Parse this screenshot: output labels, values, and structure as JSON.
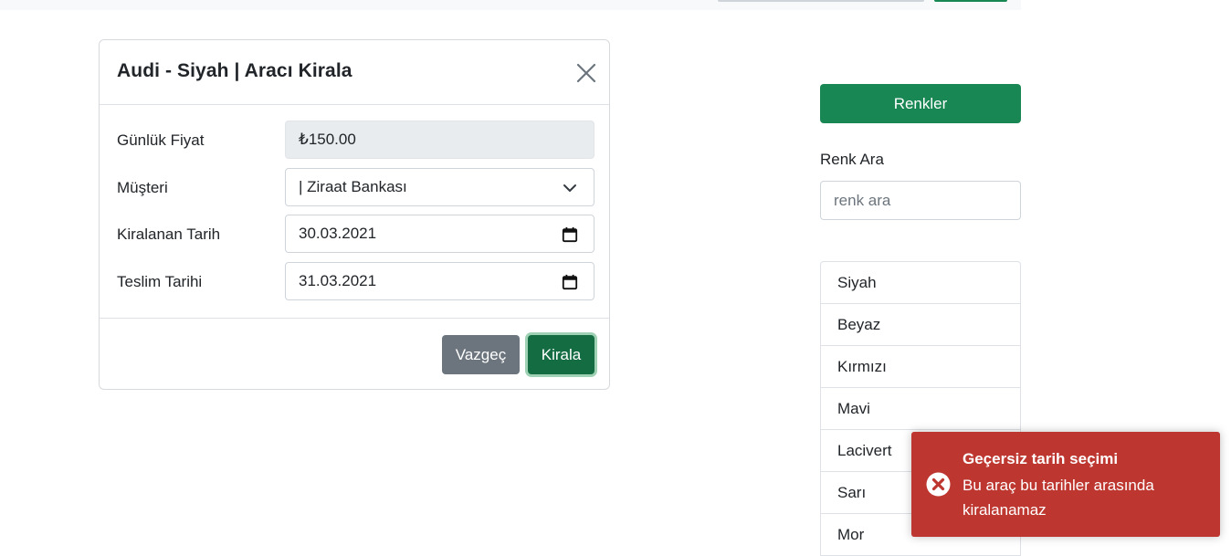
{
  "modal": {
    "title": "Audi - Siyah | Aracı Kirala",
    "fields": [
      {
        "label": "Günlük Fiyat",
        "value": "₺150.00"
      },
      {
        "label": "Müşteri",
        "value": "| Ziraat Bankası"
      },
      {
        "label": "Kiralanan Tarih",
        "value": "30.03.2021"
      },
      {
        "label": "Teslim Tarihi",
        "value": "31.03.2021"
      }
    ],
    "cancel_label": "Vazgeç",
    "rent_label": "Kirala"
  },
  "sidebar": {
    "colors_button": "Renkler",
    "search_label": "Renk Ara",
    "search_placeholder": "renk ara",
    "items": [
      "Siyah",
      "Beyaz",
      "Kırmızı",
      "Mavi",
      "Lacivert",
      "Sarı",
      "Mor"
    ]
  },
  "toast": {
    "title": "Geçersiz tarih seçimi",
    "message": "Bu araç bu tarihler arasında kiralanamaz"
  },
  "colors": {
    "primary_green": "#198754",
    "dark_green": "#146c43",
    "secondary_gray": "#6c757d",
    "error_red": "#bd362f"
  },
  "icons": [
    "close-icon",
    "chevron-down-icon",
    "calendar-icon",
    "error-icon"
  ]
}
